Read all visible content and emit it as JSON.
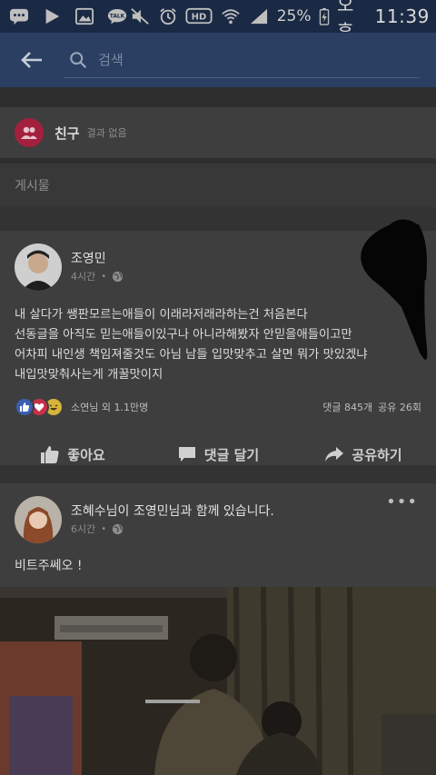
{
  "status_bar": {
    "battery": "25%",
    "period": "오후",
    "time": "11:39",
    "hd": "HD",
    "talk": "TALK"
  },
  "header": {
    "search_placeholder": "검색"
  },
  "friends": {
    "title": "친구",
    "subtitle": "결과 없음"
  },
  "posts_heading": "게시물",
  "post1": {
    "author": "조영민",
    "time": "4시간",
    "lines": [
      "내 살다가 쌩판모르는애들이 이래라저래라하는건 처음본다",
      "선동글을 아직도 믿는애들이있구나 아니라해봤자 안믿을애들이고만",
      "어차피 내인생 책임져줄것도 아님 남들 입맛맞추고 살면 뭐가 맛있겠냐",
      "내입맛맞춰사는게 개꿀맛이지"
    ],
    "reactions_text": "소연님 외 1.1만명",
    "comments": "댓글 845개",
    "shares": "공유 26회"
  },
  "actions": {
    "like": "좋아요",
    "comment": "댓글 달기",
    "share": "공유하기"
  },
  "post2": {
    "header_text": "조혜수님이 조영민님과 함께 있습니다.",
    "time": "6시간",
    "text": "비트주쎄오 !"
  },
  "colors": {
    "status_bar_bg": "#1b2a44",
    "header_bg": "#2b3f62",
    "friends_icon": "#a3203f",
    "like_blue": "#3b5fb0"
  }
}
